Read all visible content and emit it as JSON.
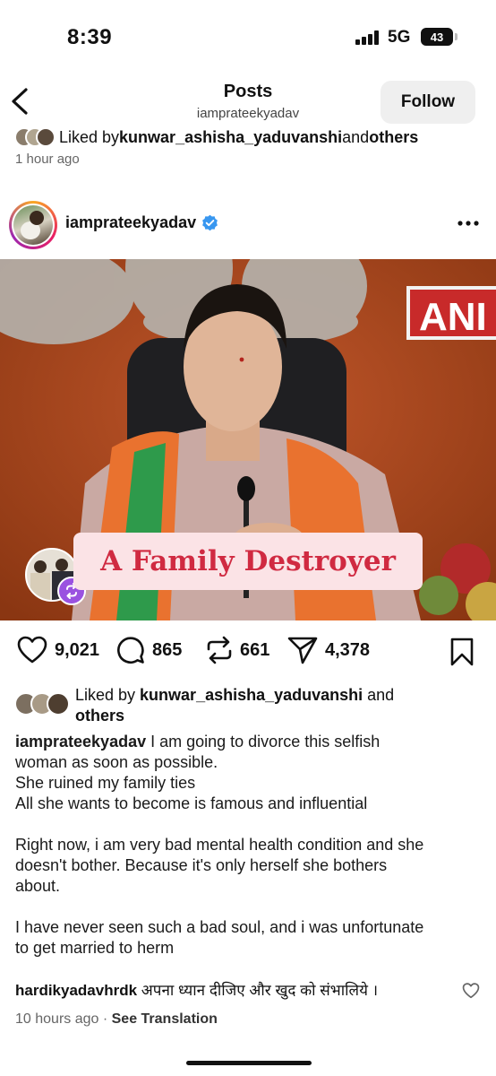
{
  "status_bar": {
    "time": "8:39",
    "network": "5G",
    "battery": "43"
  },
  "header": {
    "title": "Posts",
    "subtitle": "iamprateekyadav",
    "follow_label": "Follow"
  },
  "previous_post": {
    "liked_prefix": "Liked by ",
    "liked_user": "kunwar_ashisha_yaduvanshi",
    "liked_and": " and ",
    "liked_others": "others",
    "time": "1 hour ago"
  },
  "post": {
    "username": "iamprateekyadav",
    "overlay_caption": "A Family Destroyer",
    "channel_tag": "ANI",
    "stats": {
      "likes": "9,021",
      "comments": "865",
      "reposts": "661",
      "shares": "4,378"
    },
    "liked_prefix": "Liked by ",
    "liked_user": "kunwar_ashisha_yaduvanshi",
    "liked_and": " and",
    "liked_others": "others",
    "caption_user": "iamprateekyadav",
    "caption_lines": [
      "I am going to divorce this selfish",
      "woman as soon as possible.",
      "She ruined my family ties",
      "All she wants to become is famous and influential",
      "",
      "Right now, i am very bad mental health condition and she",
      "doesn't bother. Because it's only herself she bothers",
      "about.",
      "",
      "I have never seen such a bad soul, and i was unfortunate",
      "to get married to herm"
    ]
  },
  "comment": {
    "user": "hardikyadavhrdk",
    "text": "अपना ध्यान दीजिए और खुद को संभालिये ।",
    "time": "10 hours ago",
    "separator": " · ",
    "see_translation": "See Translation"
  },
  "colors": {
    "overlay_text": "#d02a41",
    "overlay_bg": "#fbe3e6",
    "verified": "#3897f0",
    "repost": "#9a52e0"
  },
  "icons": [
    "back-chevron-icon",
    "verified-icon",
    "more-icon",
    "heart-icon",
    "comment-icon",
    "repost-icon",
    "share-icon",
    "bookmark-icon"
  ]
}
